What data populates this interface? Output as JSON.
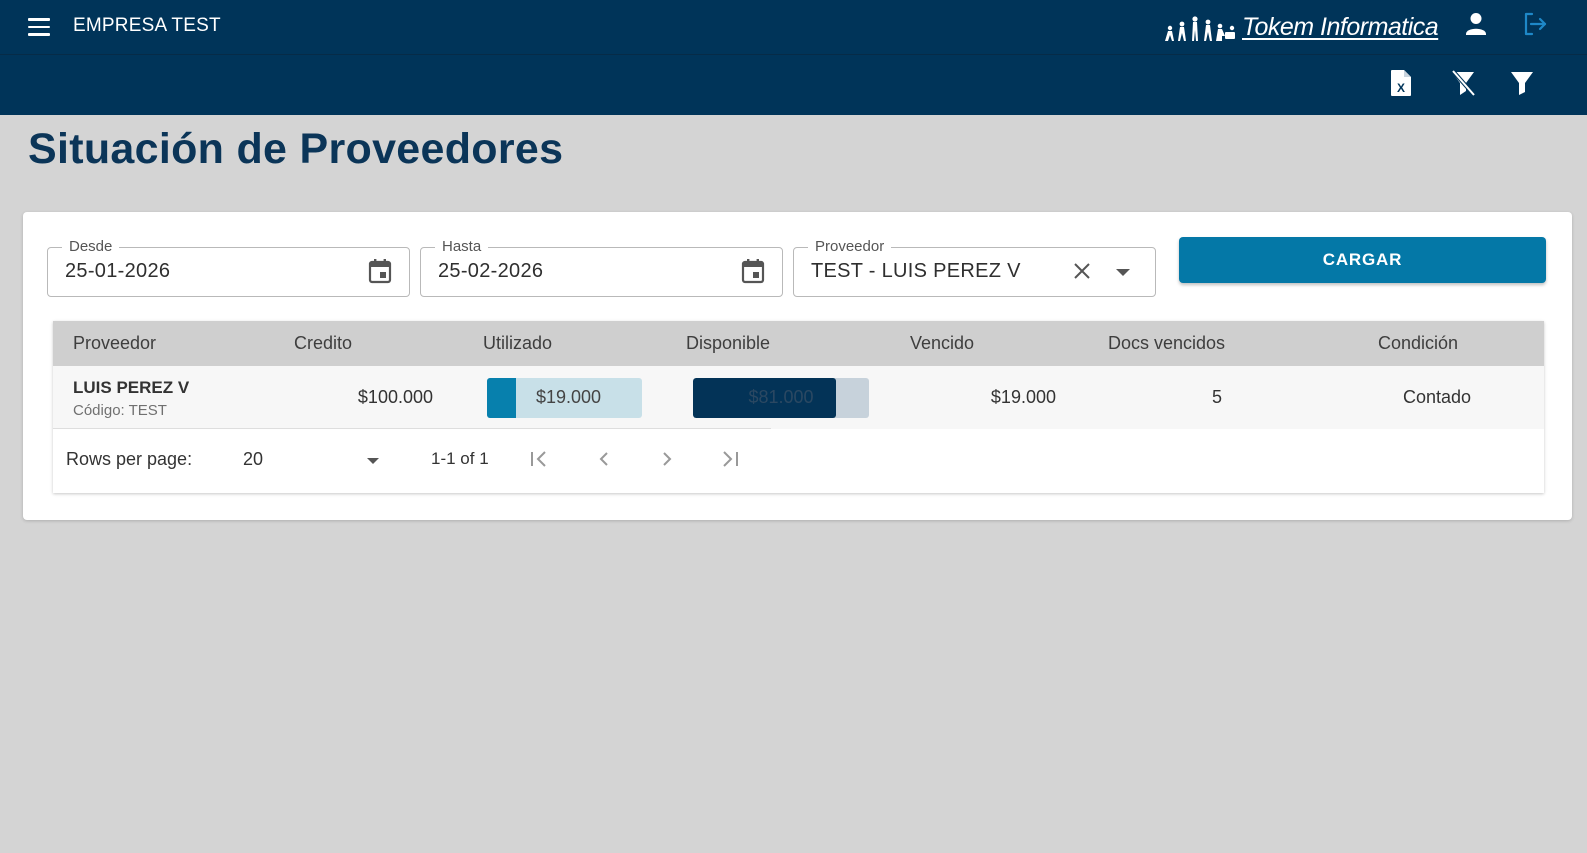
{
  "app": {
    "title": "EMPRESA TEST",
    "brand": "Tokem Informatica"
  },
  "toolbar": {
    "icons": [
      "excel-export-icon",
      "clear-filter-icon",
      "filter-icon"
    ]
  },
  "page": {
    "title": "Situación de Proveedores"
  },
  "filters": {
    "desde_label": "Desde",
    "desde_value": "25-01-2026",
    "hasta_label": "Hasta",
    "hasta_value": "25-02-2026",
    "proveedor_label": "Proveedor",
    "proveedor_value": "TEST - LUIS PEREZ V",
    "cargar_label": "CARGAR"
  },
  "table": {
    "columns": [
      "Proveedor",
      "Credito",
      "Utilizado",
      "Disponible",
      "Vencido",
      "Docs vencidos",
      "Condición"
    ],
    "rows": [
      {
        "proveedor": "LUIS PEREZ V",
        "codigo": "Código: TEST",
        "credito": "$100.000",
        "utilizado": "$19.000",
        "utilizado_fraction": 0.19,
        "disponible": "$81.000",
        "disponible_fraction": 0.81,
        "vencido": "$19.000",
        "docs_vencidos": "5",
        "condicion": "Contado"
      }
    ]
  },
  "pagination": {
    "rows_per_page_label": "Rows per page:",
    "rows_per_page_value": "20",
    "range": "1-1 of 1"
  },
  "colors": {
    "appbar": "#003459",
    "accent": "#0478a7",
    "title": "#0b3558"
  }
}
